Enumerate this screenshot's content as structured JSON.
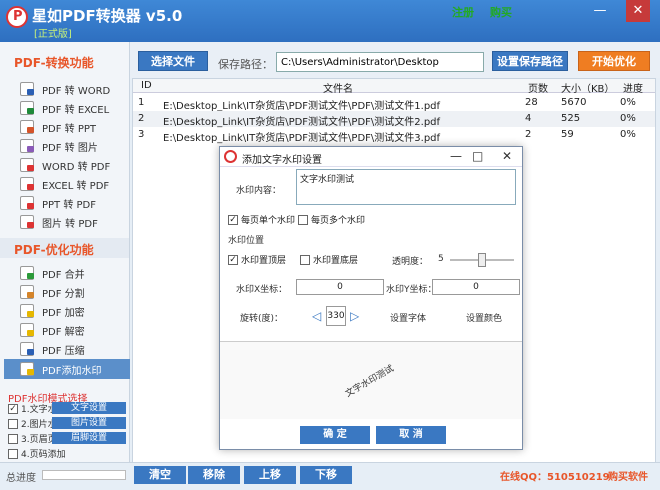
{
  "app": {
    "title": "星如PDF转换器 v5.0",
    "trial": "[正式版]",
    "register": "注册",
    "buy": "购买",
    "min_glyph": "—",
    "max_glyph": "□",
    "close_glyph": "✕"
  },
  "toolbar": {
    "select_file": "选择文件",
    "save_path_label": "保存路径：",
    "save_path_value": "C:\\Users\\Administrator\\Desktop",
    "set_save_path": "设置保存路径",
    "start_optimize": "开始优化"
  },
  "sidebar": {
    "convert_title": "PDF-转换功能",
    "convert_items": [
      "PDF 转 WORD",
      "PDF 转 EXCEL",
      "PDF 转 PPT",
      "PDF 转 图片",
      "WORD 转 PDF",
      "EXCEL 转 PDF",
      "PPT 转 PDF",
      "图片 转 PDF"
    ],
    "optimize_title": "PDF-优化功能",
    "optimize_items": [
      "PDF 合并",
      "PDF 分割",
      "PDF 加密",
      "PDF 解密",
      "PDF 压缩",
      "PDF添加水印"
    ],
    "mode_title": "PDF水印模式选择",
    "modes": [
      {
        "label": "1.文字水印",
        "checked": true,
        "button": "文字设置"
      },
      {
        "label": "2.图片水印",
        "checked": false,
        "button": "图片设置"
      },
      {
        "label": "3.页眉页脚",
        "checked": false,
        "button": "眉脚设置"
      },
      {
        "label": "4.页码添加",
        "checked": false,
        "button": ""
      }
    ],
    "checkmark": "✓"
  },
  "table": {
    "headers": [
      "ID",
      "文件名",
      "页数",
      "大小（KB）",
      "进度"
    ],
    "rows": [
      {
        "id": "1",
        "name": "E:\\Desktop_Link\\IT杂货店\\PDF测试文件\\PDF\\测试文件1.pdf",
        "pages": "28",
        "size": "5670",
        "progress": "0%"
      },
      {
        "id": "2",
        "name": "E:\\Desktop_Link\\IT杂货店\\PDF测试文件\\PDF\\测试文件2.pdf",
        "pages": "4",
        "size": "525",
        "progress": "0%"
      },
      {
        "id": "3",
        "name": "E:\\Desktop_Link\\IT杂货店\\PDF测试文件\\PDF\\测试文件3.pdf",
        "pages": "2",
        "size": "59",
        "progress": "0%"
      }
    ]
  },
  "bottom": {
    "progress_label": "总进度",
    "progress_value": 0,
    "clear": "清空",
    "remove": "移除",
    "up": "上移",
    "down": "下移",
    "qq": "在线QQ：510510219",
    "buy_software": "购买软件"
  },
  "dialog": {
    "title": "添加文字水印设置",
    "content_label": "水印内容：",
    "content_value": "文字水印测试",
    "single_per_page": "每页单个水印",
    "multi_per_page": "每页多个水印",
    "position_title": "水印位置",
    "top_layer": "水印置顶层",
    "bottom_layer": "水印置底层",
    "opacity_label": "透明度：",
    "opacity_value": "5",
    "x_label": "水印X坐标：",
    "x_value": "0",
    "y_label": "水印Y坐标：",
    "y_value": "0",
    "rotate_label": "旋转(度)：",
    "rotate_value": "330",
    "set_font": "设置字体",
    "set_color": "设置颜色",
    "preview_text": "文字水印测试",
    "ok": "确 定",
    "cancel": "取 消",
    "min_glyph": "—",
    "max_glyph": "□",
    "close_glyph": "✕",
    "left_arrow": "◁",
    "right_arrow": "▷"
  }
}
